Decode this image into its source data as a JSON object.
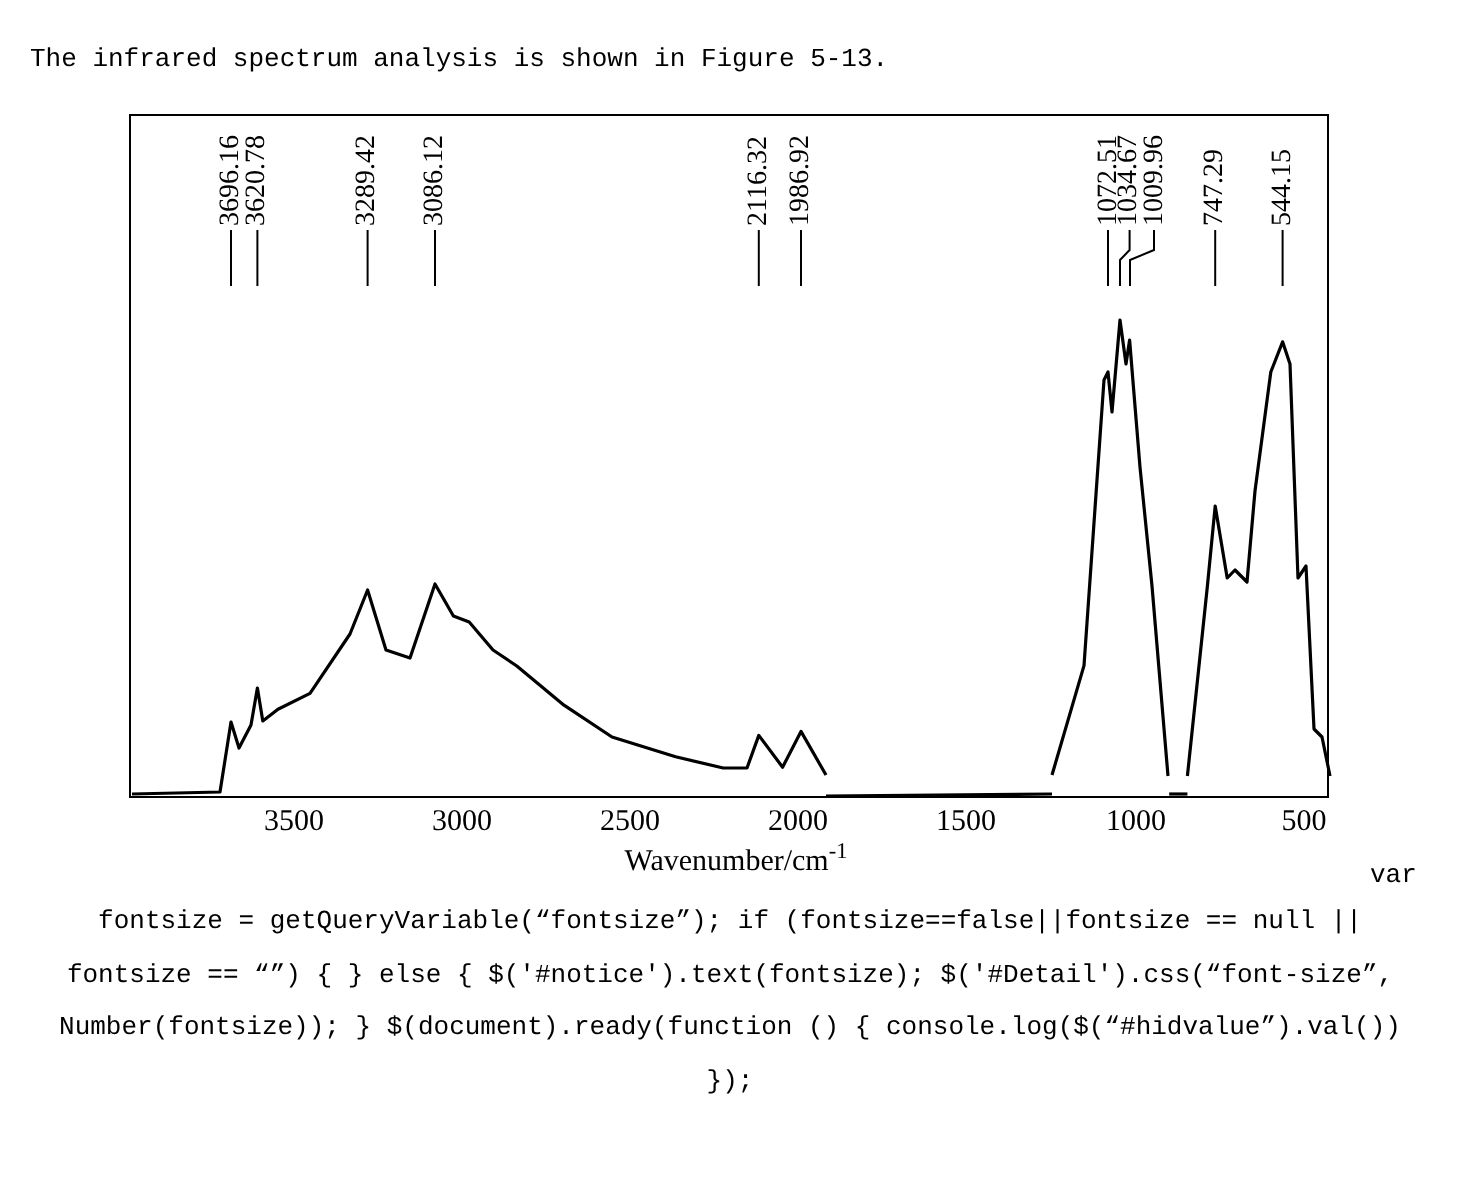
{
  "intro": "The infrared spectrum analysis is shown in Figure 5-13.",
  "figure": {
    "peak_labels": [
      "3696.16",
      "3620.78",
      "3289.42",
      "3086.12",
      "2116.32",
      "1986.92",
      "1072.51",
      "1034.67",
      "1009.96",
      "747.29",
      "544.15"
    ],
    "x_tick_labels": [
      "3500",
      "3000",
      "2500",
      "2000",
      "1500",
      "1000",
      "500"
    ],
    "xlabel": "Wavenumber/cm$^{-1}$"
  },
  "code_start": "var",
  "code": "fontsize = getQueryVariable(“fontsize”); if (fontsize==false||fontsize == null || fontsize == “”) { } else { $('#notice').text(fontsize); $('#Detail').css(“font-size”, Number(fontsize)); } $(document).ready(function () { console.log($(“#hidvalue”).val()) });"
}
